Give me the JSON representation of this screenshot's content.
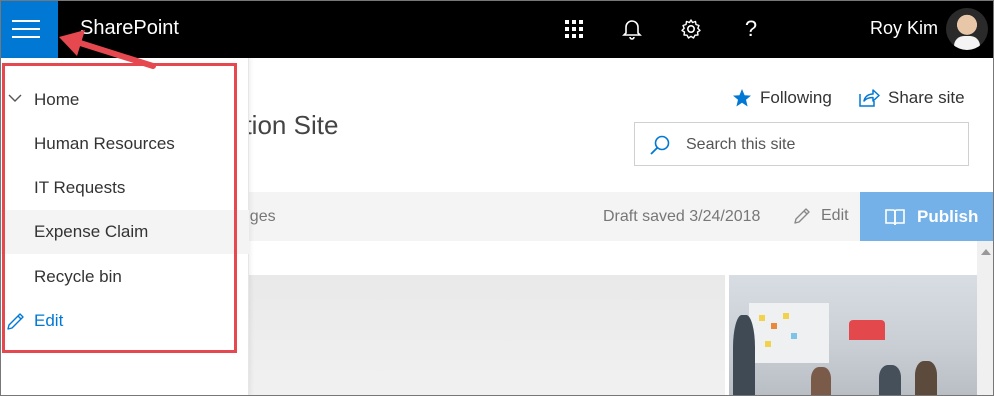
{
  "suitebar": {
    "brand": "SharePoint",
    "user_name": "Roy Kim",
    "help_glyph": "?",
    "icons": [
      "hamburger-menu-icon",
      "app-launcher-icon",
      "bell-icon",
      "gear-icon",
      "help-icon"
    ]
  },
  "nav": {
    "items": [
      {
        "label": "Home",
        "icon": "chevron-down-icon"
      },
      {
        "label": "Human Resources"
      },
      {
        "label": "IT Requests"
      },
      {
        "label": "Expense Claim"
      },
      {
        "label": "Recycle bin"
      }
    ],
    "edit_label": "Edit"
  },
  "site": {
    "title_partial": "ation Site",
    "following_label": "Following",
    "share_label": "Share site",
    "search_placeholder": "Search this site"
  },
  "command_bar": {
    "changes_partial": "anges",
    "draft_status": "Draft saved 3/24/2018",
    "edit_label": "Edit",
    "publish_label": "Publish"
  },
  "colors": {
    "accent": "#0078d4",
    "publish": "#74b1e8",
    "highlight": "#e5484f",
    "suitebar": "#000000"
  }
}
